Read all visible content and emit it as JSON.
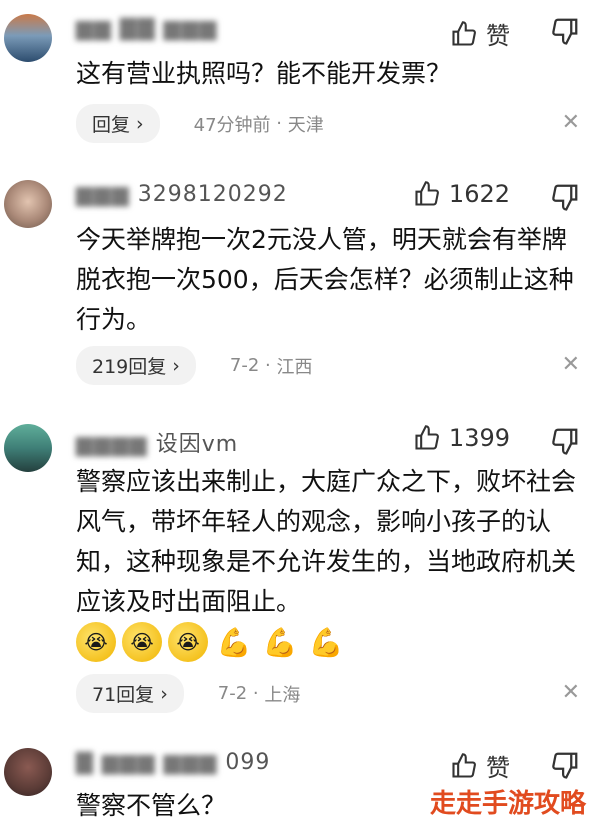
{
  "comments": [
    {
      "username": "",
      "text": "这有营业执照吗？能不能开发票？",
      "like_label": "赞",
      "reply_label": "回复",
      "time": "47分钟前",
      "location": "天津"
    },
    {
      "username": "3298120292",
      "text": "今天举牌抱一次2元没人管，明天就会有举牌脱衣抱一次500，后天会怎样？必须制止这种行为。",
      "like_count": "1622",
      "reply_label": "219回复",
      "time": "7-2",
      "location": "江西"
    },
    {
      "username": "设因vm",
      "text": "警察应该出来制止，大庭广众之下，败坏社会风气，带坏年轻人的观念，影响小孩子的认知，这种现象是不允许发生的，当地政府机关应该及时出面阻止。",
      "like_count": "1399",
      "reply_label": "71回复",
      "time": "7-2",
      "location": "上海"
    },
    {
      "username": "099",
      "text": "警察不管么？",
      "like_label": "赞"
    }
  ],
  "watermark": "走走手游攻略",
  "colors": {
    "watermark": "#e14b1f",
    "meta": "#888888"
  }
}
